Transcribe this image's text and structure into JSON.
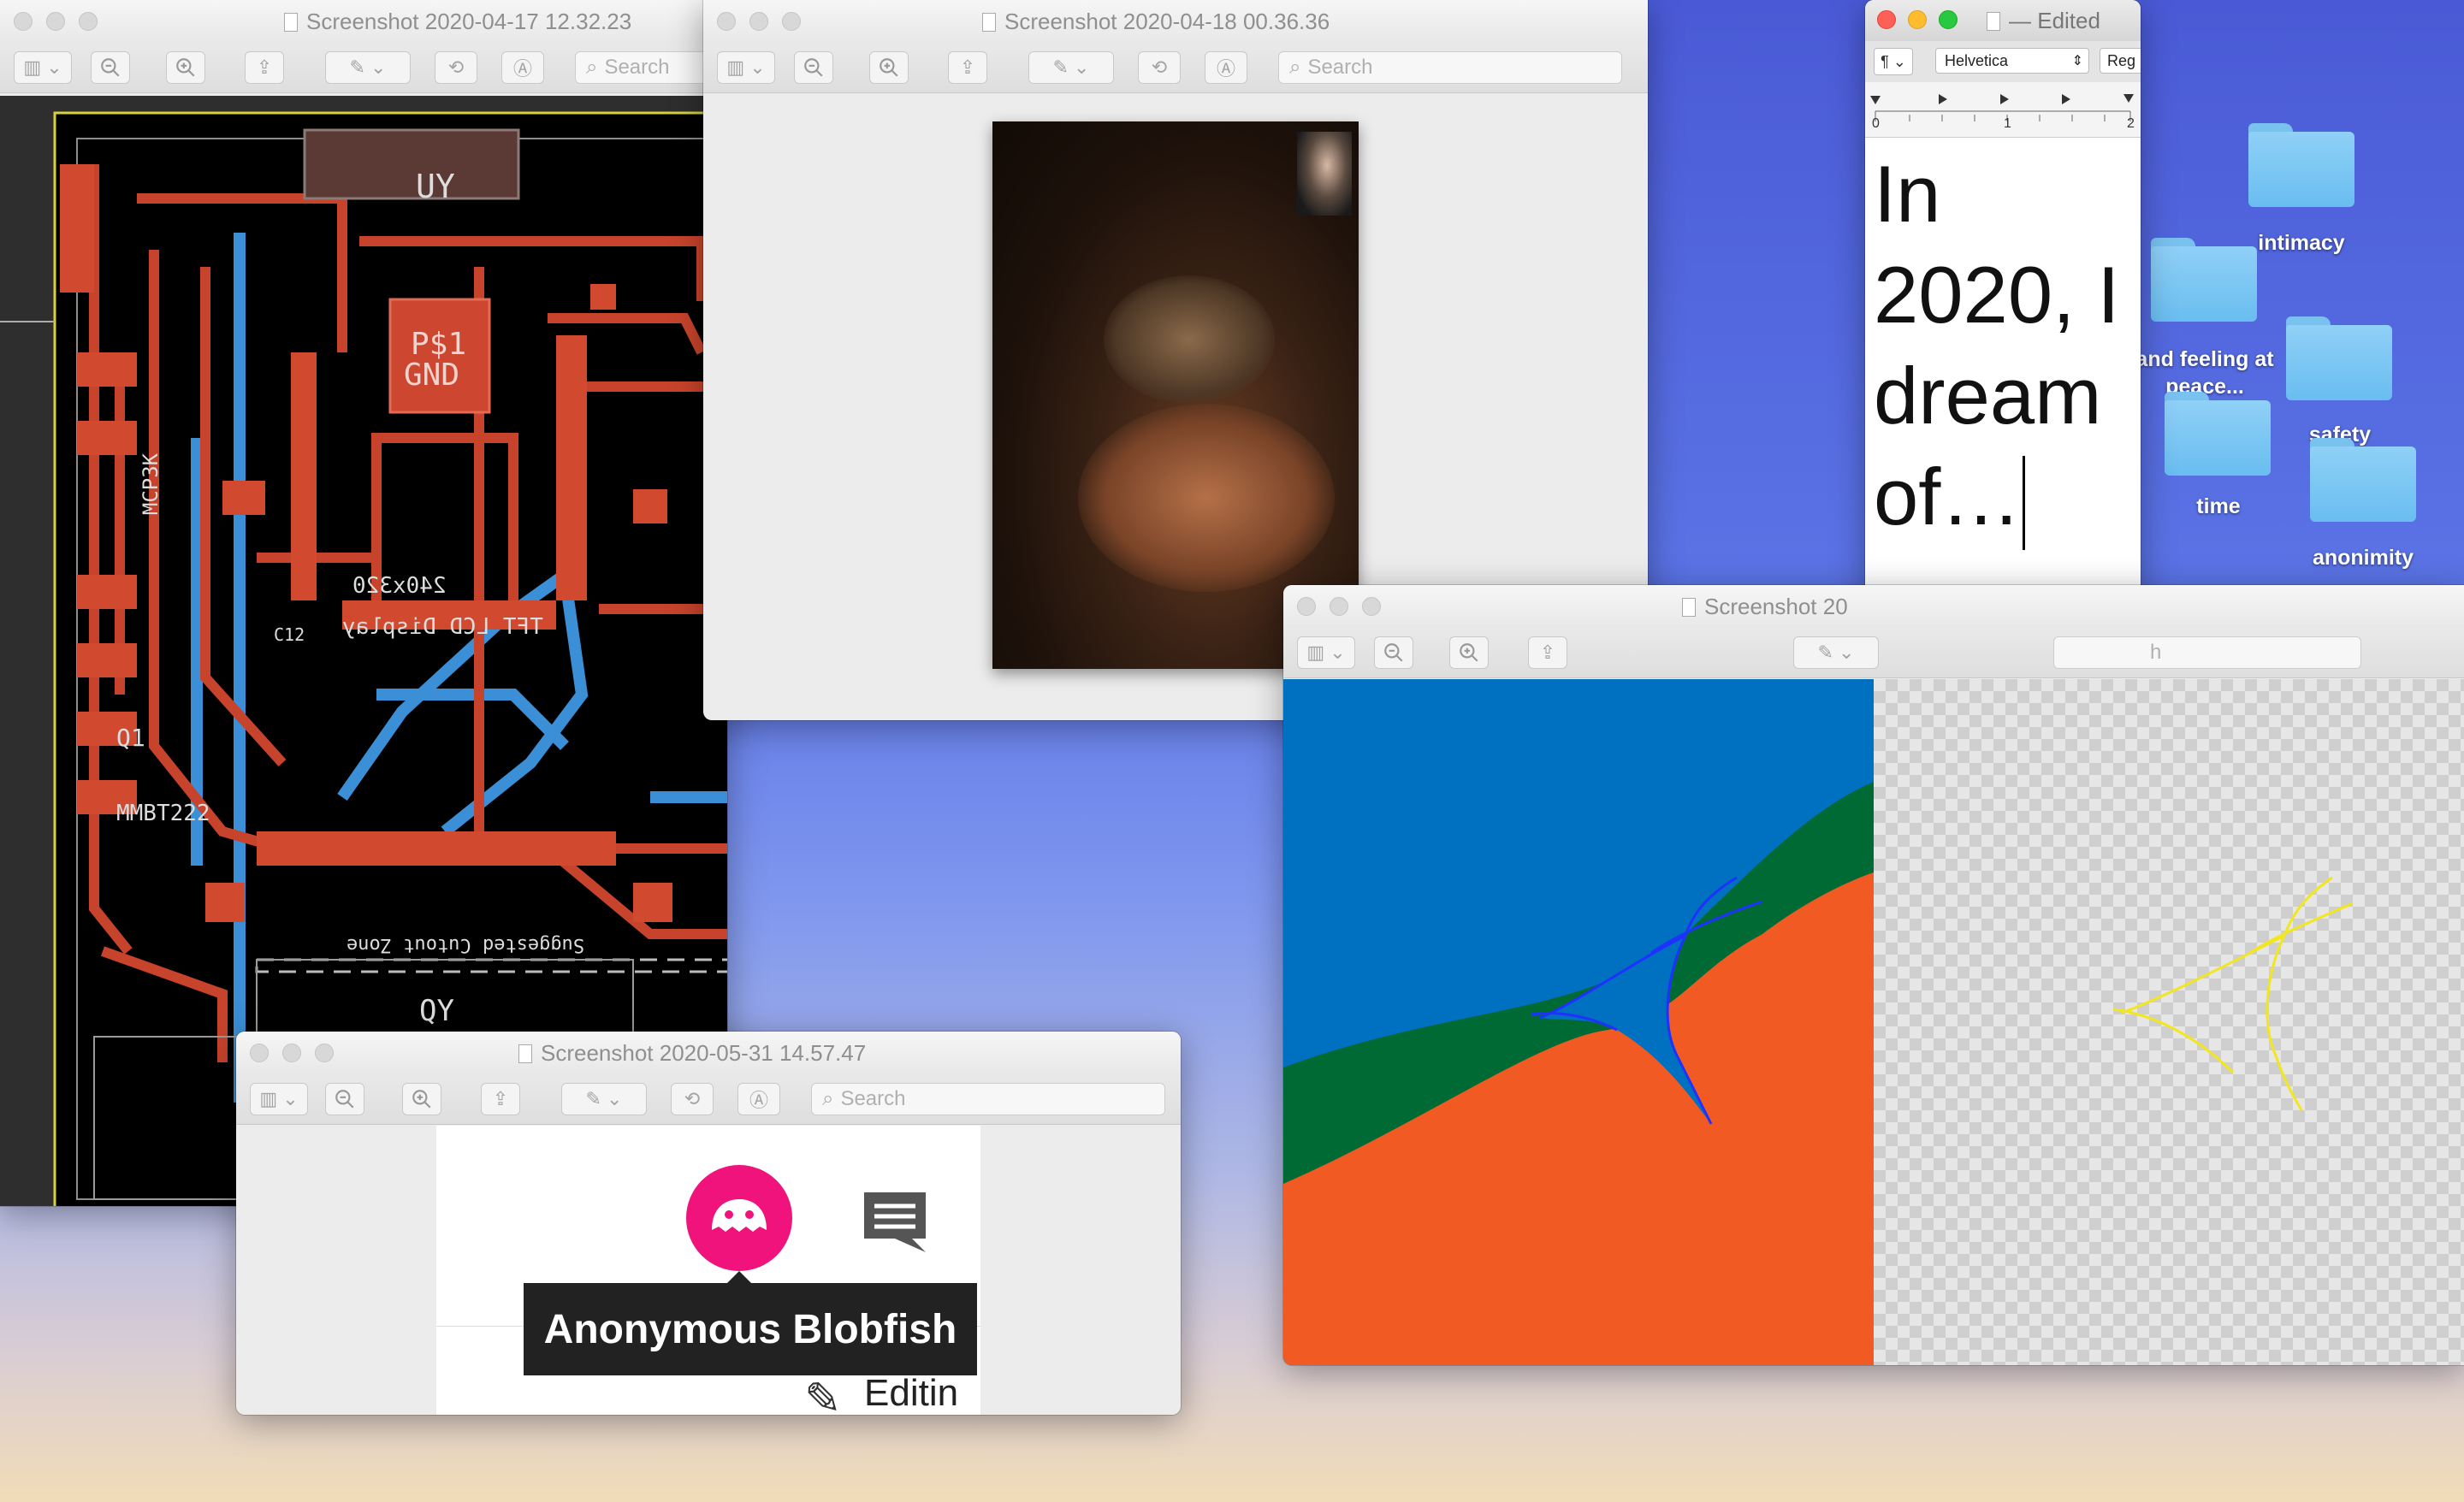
{
  "windows": {
    "pcb": {
      "title": "Screenshot 2020-04-17 12.32.23",
      "search_placeholder": "Search",
      "board_labels": {
        "u_top": "UY",
        "psu": "P$1",
        "gnd": "GND",
        "display1": "240x320",
        "display2": "TFT LCD Display",
        "cutout": "Suggested Cutout Zone",
        "u_bottom": "QY",
        "mcp": "MCP3K",
        "q1": "Q1",
        "mmbt": "MMBT222",
        "c12": "C12"
      }
    },
    "facetime": {
      "title": "Screenshot 2020-04-18 00.36.36",
      "search_placeholder": "Search"
    },
    "textedit": {
      "title": "— Edited",
      "para_label": "¶",
      "font": "Helvetica",
      "style": "Reg",
      "ruler": [
        "0",
        "1",
        "2"
      ],
      "body_lines": [
        "In",
        "2020, I",
        "dream",
        "of…"
      ]
    },
    "blob": {
      "title": "Screenshot 2020-05-31 14.57.47",
      "search_placeholder": "Search",
      "tooltip": "Anonymous Blobfish",
      "editing": "Editin"
    },
    "vector": {
      "title": "Screenshot 20",
      "search_partial": "h"
    }
  },
  "desktop": {
    "folders": [
      {
        "label": "intimacy"
      },
      {
        "label": "and feeling at peace..."
      },
      {
        "label": "safety"
      },
      {
        "label": "time"
      },
      {
        "label": "anonimity"
      }
    ]
  },
  "colors": {
    "pcb_trace": "#c8432b",
    "pcb_bg": "#000000",
    "blob_pink": "#f0137c",
    "vec_blue": "#0070c0",
    "vec_green": "#006a35",
    "vec_orange": "#f15a22"
  }
}
